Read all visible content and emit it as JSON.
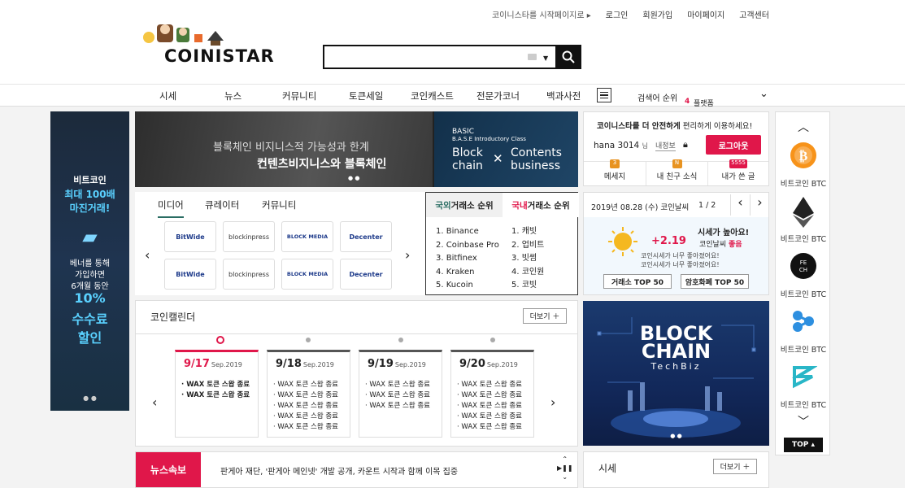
{
  "header": {
    "util_links": {
      "start": "코이니스타를 시작페이지로 ▸",
      "login": "로그인",
      "signup": "회원가입",
      "mypage": "마이페이지",
      "support": "고객센터"
    },
    "logo_text": "COINISTAR",
    "search": {
      "value": "",
      "placeholder": ""
    }
  },
  "nav": {
    "items": [
      "시세",
      "뉴스",
      "커뮤니티",
      "토큰세일",
      "코인캐스트",
      "전문가코너",
      "백과사전"
    ],
    "rank_label": "검색어 순위",
    "rank_num": "4",
    "rank_word": "플랫폼"
  },
  "left_banner": {
    "line1": "비트코인",
    "line2": "최대 100배",
    "line3": "마진거래!",
    "line4": "베너를 통해",
    "line5": "가입하면",
    "line6": "6개월 동안",
    "line7": "10%",
    "line8": "수수료",
    "line9": "할인"
  },
  "main_banner": {
    "left_line1": "블록체인 비지니스적 가능성과 한계",
    "left_line2": "컨텐츠비지니스와 블록체인",
    "right_small1": "BASIC",
    "right_small2": "B.A.S.E Introductory Class",
    "right_big1": "Block",
    "right_big2": "chain",
    "right_x": "✕",
    "right_big3": "Contents",
    "right_big4": "business"
  },
  "media": {
    "tabs": [
      "미디어",
      "큐레이터",
      "커뮤니티"
    ],
    "logos": [
      "BitWide",
      "blockinpress",
      "BLOCK MEDIA",
      "Decenter",
      "BitWide",
      "blockinpress",
      "BLOCK MEDIA",
      "Decenter"
    ]
  },
  "exchange": {
    "domestic_prefix": "국외",
    "domestic_title": "거래소 순위",
    "korea_prefix": "국내",
    "korea_title": "거래소 순위",
    "foreign": [
      "1. Binance",
      "2. Coinbase Pro",
      "3. Bitfinex",
      "4. Kraken",
      "5. Kucoin"
    ],
    "korean": [
      "1. 캐빗",
      "2. 업비트",
      "3. 빗썸",
      "4. 코인원",
      "5. 코빗"
    ]
  },
  "login": {
    "notice_bold": "코이니스타를 더 안전하게",
    "notice_rest": " 편리하게 이용하세요!",
    "user": "hana 3014",
    "user_suffix": "님",
    "info_link": "내정보",
    "logout": "로그아웃",
    "stats": [
      {
        "count": "3",
        "label": "메세지"
      },
      {
        "count": "N",
        "label": "내 친구 소식"
      },
      {
        "count": "5555",
        "label": "내가 쓴 글"
      }
    ]
  },
  "coin_weather": {
    "date": "2019년 08.28 (수) 코인날씨",
    "page": "1 / 2",
    "headline": "시세가 높아요!",
    "change": "+2.19",
    "sub_label": "코인날씨",
    "sub_status": "좋음",
    "msg1": "코인시세가 너무 좋아졌어요!",
    "msg2": "코인시세가 너무 좋아졌어요!",
    "btn1": "거래소 TOP 50",
    "btn2": "암호화폐 TOP 50"
  },
  "calendar": {
    "title": "코인캘린더",
    "more": "더보기",
    "cards": [
      {
        "date": "9/17",
        "sub": "Sep.2019",
        "items": [
          "· WAX 토큰 스왑 종료",
          "· WAX 토큰 스왑 종료"
        ]
      },
      {
        "date": "9/18",
        "sub": "Sep.2019",
        "items": [
          "· WAX 토큰 스왑 종료",
          "· WAX 토큰 스왑 종료",
          "· WAX 토큰 스왑 종료",
          "· WAX 토큰 스왑 종료",
          "· WAX 토큰 스왑 종료"
        ]
      },
      {
        "date": "9/19",
        "sub": "Sep.2019",
        "items": [
          "· WAX 토큰 스왑 종료",
          "· WAX 토큰 스왑 종료",
          "· WAX 토큰 스왑 종료"
        ]
      },
      {
        "date": "9/20",
        "sub": "Sep.2019",
        "items": [
          "· WAX 토큰 스왑 종료",
          "· WAX 토큰 스왑 종료",
          "· WAX 토큰 스왑 종료",
          "· WAX 토큰 스왑 종료",
          "· WAX 토큰 스왑 종료"
        ]
      }
    ]
  },
  "big_banner": {
    "line1": "BLOCK",
    "line2": "CHAIN",
    "line3": "TechBiz"
  },
  "news_flash": {
    "label": "뉴스속보",
    "headline": "판게아 재단, '판게아 메인넷' 개발 공개, 카운트 시작과 함께 이목 집중"
  },
  "sise": {
    "title": "시세",
    "more": "더보기"
  },
  "right_bar": {
    "coins": [
      "비트코인 BTC",
      "비트코인 BTC",
      "비트코인 BTC",
      "비트코인 BTC",
      "비트코인 BTC"
    ],
    "top_label": "TOP ▴"
  },
  "colors": {
    "accent": "#e0174a",
    "dark": "#111111",
    "green_tab": "#2a6d63"
  }
}
